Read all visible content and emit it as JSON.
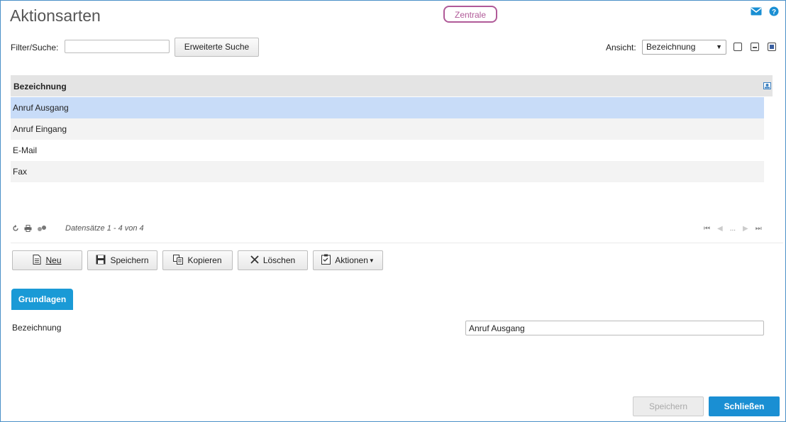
{
  "header": {
    "title": "Aktionsarten",
    "context_badge": "Zentrale"
  },
  "icons": {
    "mail": "mail-icon",
    "help": "help-icon"
  },
  "filter": {
    "label": "Filter/Suche:",
    "value": "",
    "advanced_search_label": "Erweiterte Suche",
    "view_label": "Ansicht:",
    "view_selected": "Bezeichnung"
  },
  "grid": {
    "column_header": "Bezeichnung",
    "rows": [
      "Anruf Ausgang",
      "Anruf Eingang",
      "E-Mail",
      "Fax"
    ],
    "selected_row": "Anruf Ausgang",
    "record_info": "Datensätze 1 - 4 von 4",
    "pager_ellipsis": "..."
  },
  "actions": {
    "new": "Neu",
    "save": "Speichern",
    "copy": "Kopieren",
    "delete": "Löschen",
    "more": "Aktionen"
  },
  "detail": {
    "tab": "Grundlagen",
    "field_label": "Bezeichnung",
    "field_value": "Anruf Ausgang"
  },
  "footer": {
    "save": "Speichern",
    "close": "Schließen"
  },
  "colors": {
    "accent": "#1a9ad6",
    "badge": "#b05a98",
    "selection": "#c8dcf8"
  }
}
